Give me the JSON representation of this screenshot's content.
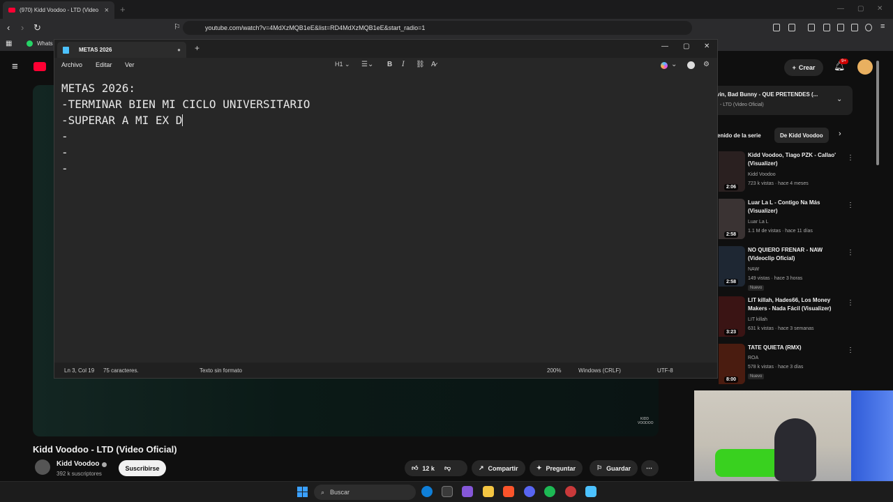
{
  "browser": {
    "tab_title": "(970) Kidd Voodoo - LTD (Video",
    "url": "youtube.com/watch?v=4MdXzMQB1eE&list=RD4MdXzMQB1eE&start_radio=1",
    "bookmark_label": "Whats"
  },
  "notepad": {
    "tab_title": "METAS 2026",
    "menus": [
      "Archivo",
      "Editar",
      "Ver"
    ],
    "heading_select": "H1",
    "lines": [
      "METAS 2026:",
      "-TERMINAR BIEN MI CICLO UNIVERSITARIO",
      "-SUPERAR A MI EX D",
      "-",
      "-",
      "-"
    ],
    "status": {
      "position": "Ln 3, Col 19",
      "chars": "75 caracteres.",
      "format": "Texto sin formato",
      "zoom": "200%",
      "line_endings": "Windows (CRLF)",
      "encoding": "UTF-8"
    }
  },
  "youtube": {
    "create_label": "Crear",
    "notif_count": "9+",
    "video_title": "Kidd Voodoo - LTD (Video Oficial)",
    "channel": "Kidd Voodoo",
    "subscribers": "392 k suscriptores",
    "subscribe_label": "Suscribirse",
    "likes": "12 k",
    "share_label": "Compartir",
    "ask_label": "Preguntar",
    "save_label": "Guardar",
    "playlist_title": "vin, Bad Bunny - QUE PRETENDES (...",
    "playlist_sub": "- LTD (Video Oficial)",
    "chips": [
      "enido de la serie",
      "De Kidd Voodoo"
    ],
    "watermark": "KIDD VOODOO",
    "recs": [
      {
        "title": "Kidd Voodoo, Tiago PZK - Callao' (Visualizer)",
        "channel": "Kidd Voodoo",
        "meta": "723 k vistas · hace 4 meses",
        "duration": "2:06",
        "badge": ""
      },
      {
        "title": "Luar La L - Contigo Na Más (Visualizer)",
        "channel": "Luar La L",
        "meta": "1.1 M de vistas · hace 11 días",
        "duration": "2:58",
        "badge": ""
      },
      {
        "title": "NO QUIERO FRENAR - NAW (Videoclip Oficial)",
        "channel": "NAW",
        "meta": "149 vistas · hace 3 horas",
        "duration": "2:58",
        "badge": "Nuevo"
      },
      {
        "title": "LIT killah, Hades66, Los Money Makers - Nada Fácil (Visualizer)",
        "channel": "LIT killah",
        "meta": "631 k vistas · hace 3 semanas",
        "duration": "3:23",
        "badge": ""
      },
      {
        "title": "TATE QUIETA (RMX)",
        "channel": "ROA",
        "meta": "578 k vistas · hace 3 días",
        "duration": "8:00",
        "badge": "Nuevo"
      }
    ]
  },
  "taskbar": {
    "search_placeholder": "Buscar"
  },
  "colors": {
    "yt_red": "#ff0033",
    "notepad_bg": "#272727",
    "accent_blue": "#3aa0ff"
  }
}
